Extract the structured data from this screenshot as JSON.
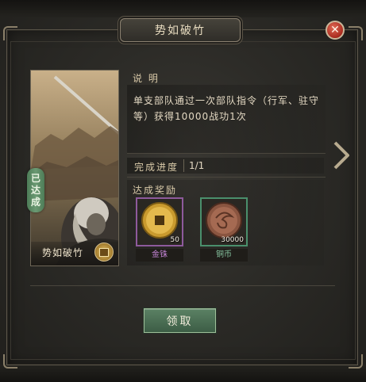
{
  "dialog": {
    "title": "势如破竹"
  },
  "card": {
    "name": "势如破竹",
    "stamp_chars": [
      "已",
      "达",
      "成"
    ]
  },
  "description": {
    "label": "说 明",
    "text": "单支部队通过一次部队指令（行军、驻守等）获得10000战功1次"
  },
  "progress": {
    "label": "完成进度",
    "value": "1/1"
  },
  "rewards": {
    "label": "达成奖励",
    "items": [
      {
        "name": "金铢",
        "count": "50",
        "icon": "gold-coin-icon",
        "frame_color": "#8e5a9c"
      },
      {
        "name": "铜币",
        "count": "30000",
        "icon": "copper-coin-icon",
        "frame_color": "#4a8f6c"
      }
    ]
  },
  "actions": {
    "claim_label": "领取"
  },
  "colors": {
    "accent_green": "#4d7c57",
    "close_red": "#a92b1f"
  }
}
